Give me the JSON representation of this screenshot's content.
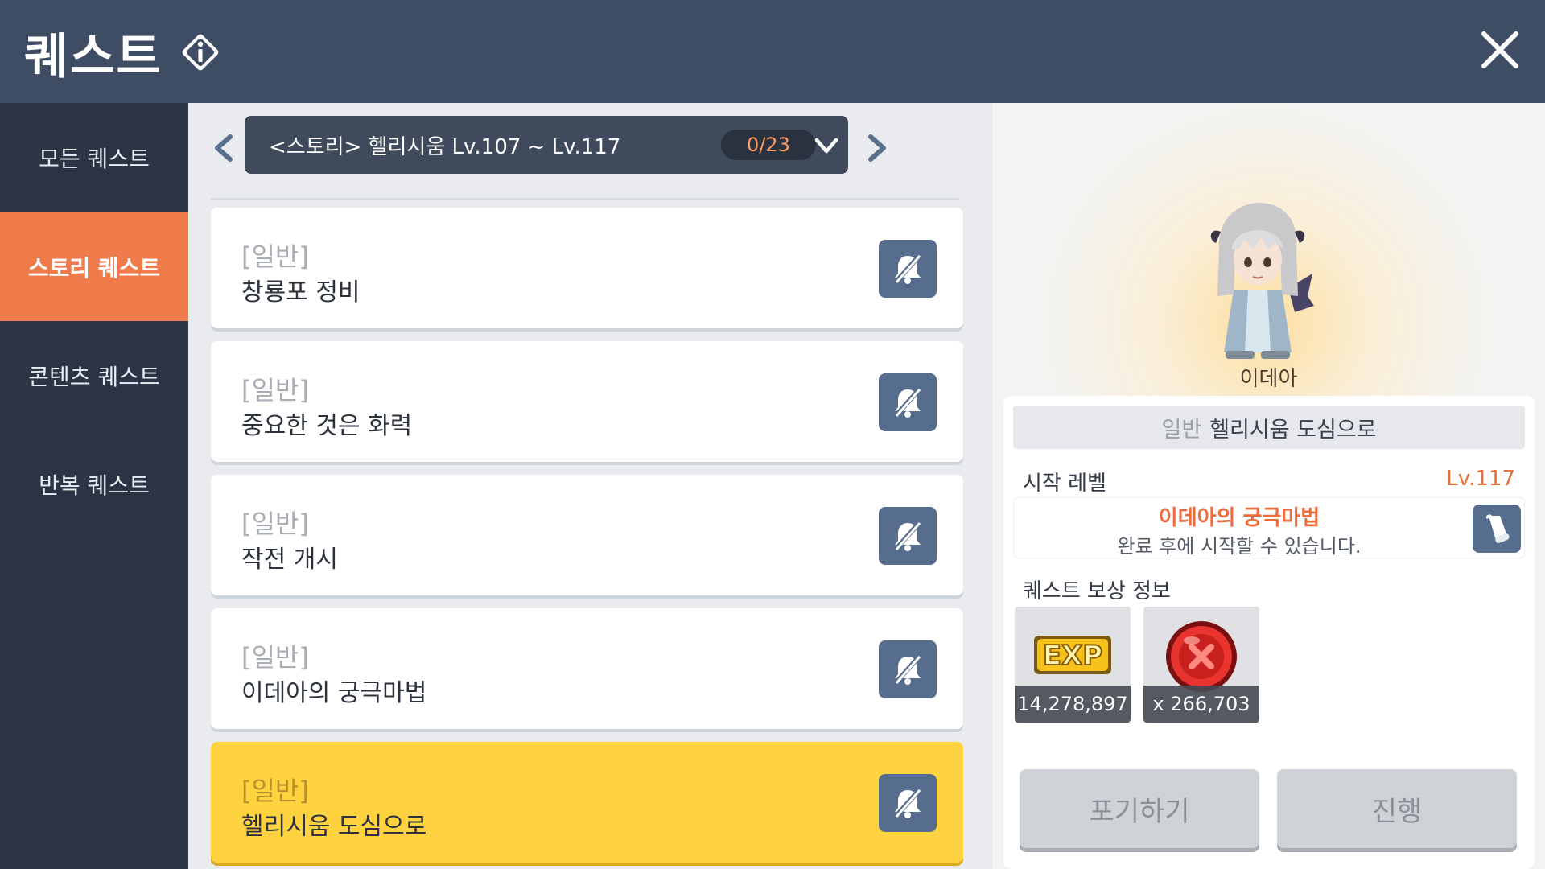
{
  "header": {
    "title": "퀘스트",
    "info_icon": "info-diamond-icon",
    "close_icon": "close-icon"
  },
  "sidebar": {
    "items": [
      {
        "label": "모든 퀘스트",
        "active": false
      },
      {
        "label": "스토리 퀘스트",
        "active": true
      },
      {
        "label": "콘텐츠 퀘스트",
        "active": false
      },
      {
        "label": "반복 퀘스트",
        "active": false
      }
    ]
  },
  "selector": {
    "label": "<스토리> 헬리시움 Lv.107 ~ Lv.117",
    "count": "0/23"
  },
  "quests": [
    {
      "tag": "[일반]",
      "name": "창룡포 정비"
    },
    {
      "tag": "[일반]",
      "name": "중요한 것은 화력"
    },
    {
      "tag": "[일반]",
      "name": "작전 개시"
    },
    {
      "tag": "[일반]",
      "name": "이데아의 궁극마법"
    },
    {
      "tag": "[일반]",
      "name": "헬리시움 도심으로",
      "selected": true
    }
  ],
  "detail": {
    "npc_name": "이데아",
    "quest_type": "일반",
    "quest_name": "헬리시움 도심으로",
    "start_level_label": "시작 레벨",
    "start_level_value": "Lv.117",
    "prereq_quest": "이데아의 궁극마법",
    "prereq_desc": "완료 후에 시작할 수 있습니다.",
    "reward_label": "퀘스트 보상 정보",
    "rewards": [
      {
        "icon": "exp-icon",
        "count": "14,278,897"
      },
      {
        "icon": "red-coin-icon",
        "count": "x 266,703"
      }
    ],
    "buttons": {
      "abandon": "포기하기",
      "proceed": "진행"
    }
  },
  "colors": {
    "header_bg": "#3f4d64",
    "sidebar_active": "#ef7a4a",
    "selected_quest": "#ffd23f",
    "accent_orange": "#f06b3c",
    "button_blue": "#566d8d"
  }
}
